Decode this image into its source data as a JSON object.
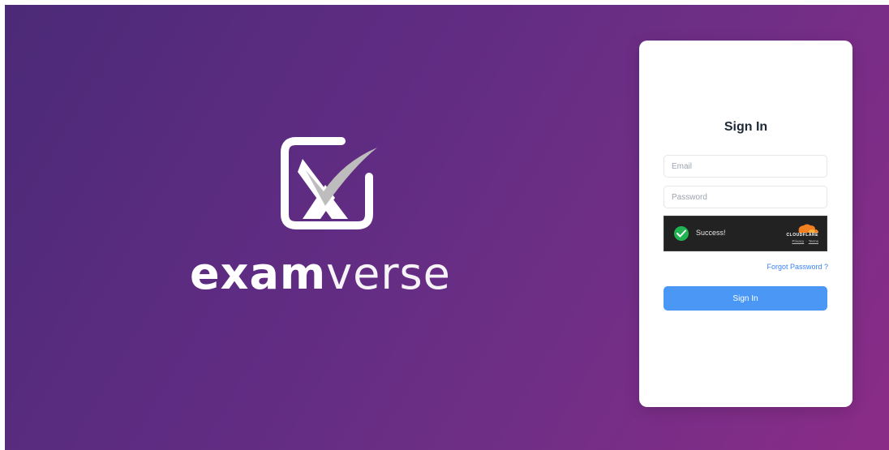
{
  "brand": {
    "word_bold": "exam",
    "word_light": "verse",
    "logo_icon": "examverse-x-check-icon"
  },
  "signin": {
    "title": "Sign In",
    "email_placeholder": "Email",
    "password_placeholder": "Password",
    "forgot_label": "Forgot Password ?",
    "button_label": "Sign In"
  },
  "captcha": {
    "status": "Success!",
    "provider": "CLOUDFLARE",
    "privacy": "Privacy",
    "separator": "·",
    "terms": "Terms"
  },
  "colors": {
    "background_start": "#4c2a78",
    "background_end": "#8a2c87",
    "button": "#4a97f6",
    "link": "#3b82f6",
    "success": "#1fb351",
    "cloudflare_orange": "#f38020"
  }
}
